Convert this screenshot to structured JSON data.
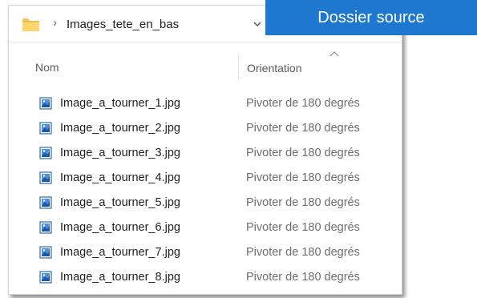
{
  "badge": {
    "label": "Dossier source",
    "color": "#1f78cf"
  },
  "address": {
    "folder_icon": "folder-icon",
    "separator": "›",
    "path": "Images_tete_en_bas",
    "dropdown_icon": "chevron-down-icon"
  },
  "columns": {
    "name": "Nom",
    "orientation": "Orientation",
    "sort_icon": "chevron-up-icon"
  },
  "files": [
    {
      "name": "Image_a_tourner_1.jpg",
      "orientation": "Pivoter de 180 degrés"
    },
    {
      "name": "Image_a_tourner_2.jpg",
      "orientation": "Pivoter de 180 degrés"
    },
    {
      "name": "Image_a_tourner_3.jpg",
      "orientation": "Pivoter de 180 degrés"
    },
    {
      "name": "Image_a_tourner_4.jpg",
      "orientation": "Pivoter de 180 degrés"
    },
    {
      "name": "Image_a_tourner_5.jpg",
      "orientation": "Pivoter de 180 degrés"
    },
    {
      "name": "Image_a_tourner_6.jpg",
      "orientation": "Pivoter de 180 degrés"
    },
    {
      "name": "Image_a_tourner_7.jpg",
      "orientation": "Pivoter de 180 degrés"
    },
    {
      "name": "Image_a_tourner_8.jpg",
      "orientation": "Pivoter de 180 degrés"
    }
  ],
  "file_icon": "image-file-icon"
}
